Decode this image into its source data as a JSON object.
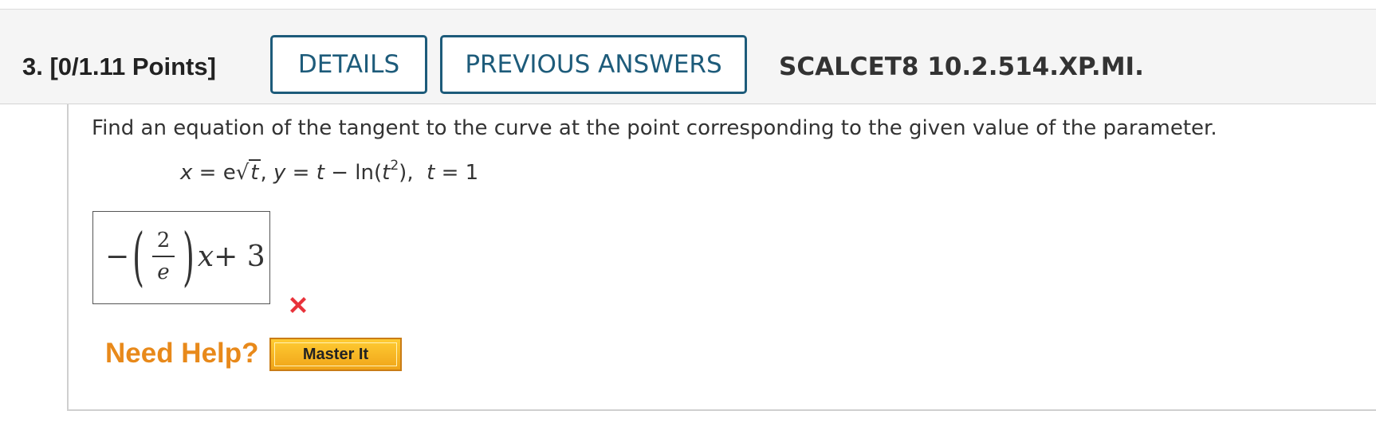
{
  "header": {
    "question_label": "3.  [0/1.11 Points]",
    "details_label": "DETAILS",
    "previous_answers_label": "PREVIOUS ANSWERS",
    "code": "SCALCET8 10.2.514.XP.MI."
  },
  "question": {
    "text": "Find an equation of the tangent to the curve at the point corresponding to the given value of the parameter.",
    "formula": {
      "x_lhs": "x",
      "eq": " = ",
      "e": "e",
      "radicand": "t",
      "comma": ",  ",
      "y_lhs": "y",
      "t1": "t",
      "minus": " − ",
      "ln": "ln(",
      "t2": "t",
      "exp": "2",
      "close": "),",
      "t3": "t",
      "eq3": " = 1"
    }
  },
  "answer": {
    "minus": "−",
    "open_paren": "(",
    "numerator": "2",
    "denominator": "e",
    "close_paren": ")",
    "var": "x",
    "rest": " + 3",
    "status_icon": "x-mark-icon",
    "status_color": "#e8323a"
  },
  "help": {
    "need_help_label": "Need Help?",
    "master_it_label": "Master It",
    "accent": "#e8891a"
  }
}
